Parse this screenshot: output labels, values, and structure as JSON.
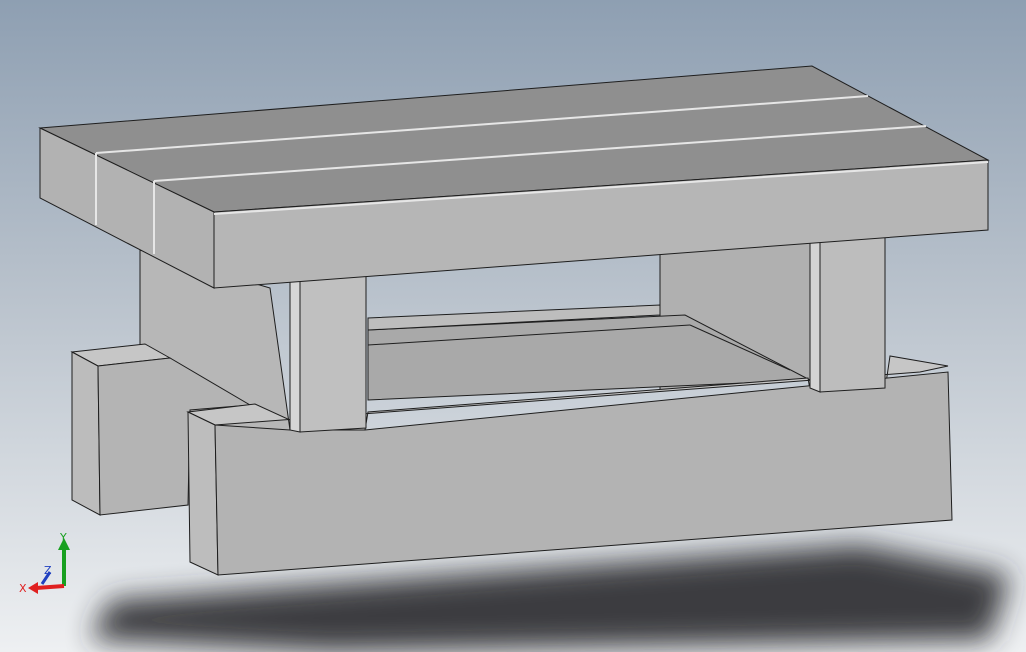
{
  "viewport": {
    "background_top": "#8e9fb2",
    "background_bottom": "#eef0f2"
  },
  "model": {
    "face_light": "#c9c9c9",
    "face_mid": "#b4b4b4",
    "face_dark": "#8f8f8f",
    "edge_color": "#1e1e1e",
    "shadow_color": "#2a2c2f"
  },
  "triad": {
    "x_label": "X",
    "y_label": "Y",
    "z_label": "Z",
    "x_color": "#e02020",
    "y_color": "#18a020",
    "z_color": "#2040c0"
  }
}
